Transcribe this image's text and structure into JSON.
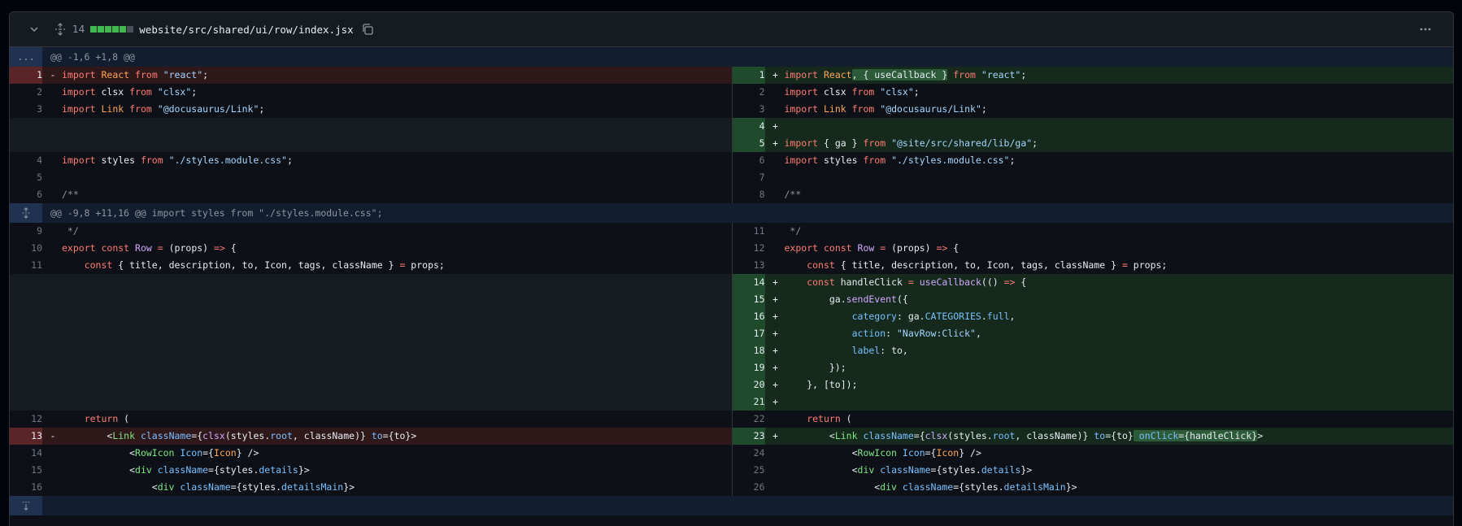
{
  "header": {
    "changes_count": "14",
    "file_path": "website/src/shared/ui/row/index.jsx",
    "diffstat": [
      "add",
      "add",
      "add",
      "add",
      "add",
      "neutral"
    ]
  },
  "hunks": [
    {
      "text": "@@ -1,6 +1,8 @@",
      "expander": "..."
    },
    {
      "text": "@@ -9,8 +11,16 @@ import styles from \"./styles.module.css\";"
    }
  ],
  "rows_a": [
    {
      "l": {
        "n": "1",
        "m": "-",
        "t": "del",
        "h": "<span class='k'>import</span> <span class='v'>React</span> <span class='k'>from</span> <span class='s'>\"react\"</span>;"
      },
      "r": {
        "n": "1",
        "m": "+",
        "t": "add",
        "h": "<span class='k'>import</span> <span class='v'>React</span><span class='hl-add'>, { useCallback }</span> <span class='k'>from</span> <span class='s'>\"react\"</span>;"
      }
    },
    {
      "l": {
        "n": "2",
        "m": "",
        "t": "",
        "h": "<span class='k'>import</span> clsx <span class='k'>from</span> <span class='s'>\"clsx\"</span>;"
      },
      "r": {
        "n": "2",
        "m": "",
        "t": "",
        "h": "<span class='k'>import</span> clsx <span class='k'>from</span> <span class='s'>\"clsx\"</span>;"
      }
    },
    {
      "l": {
        "n": "3",
        "m": "",
        "t": "",
        "h": "<span class='k'>import</span> <span class='v'>Link</span> <span class='k'>from</span> <span class='s'>\"@docusaurus/Link\"</span>;"
      },
      "r": {
        "n": "3",
        "m": "",
        "t": "",
        "h": "<span class='k'>import</span> <span class='v'>Link</span> <span class='k'>from</span> <span class='s'>\"@docusaurus/Link\"</span>;"
      }
    },
    {
      "l": {
        "n": "",
        "m": "",
        "t": "empty",
        "h": ""
      },
      "r": {
        "n": "4",
        "m": "+",
        "t": "add",
        "h": ""
      }
    },
    {
      "l": {
        "n": "",
        "m": "",
        "t": "empty",
        "h": ""
      },
      "r": {
        "n": "5",
        "m": "+",
        "t": "add",
        "h": "<span class='k'>import</span> { ga } <span class='k'>from</span> <span class='s'>\"@site/src/shared/lib/ga\"</span>;"
      }
    },
    {
      "l": {
        "n": "4",
        "m": "",
        "t": "",
        "h": "<span class='k'>import</span> styles <span class='k'>from</span> <span class='s'>\"./styles.module.css\"</span>;"
      },
      "r": {
        "n": "6",
        "m": "",
        "t": "",
        "h": "<span class='k'>import</span> styles <span class='k'>from</span> <span class='s'>\"./styles.module.css\"</span>;"
      }
    },
    {
      "l": {
        "n": "5",
        "m": "",
        "t": "",
        "h": ""
      },
      "r": {
        "n": "7",
        "m": "",
        "t": "",
        "h": ""
      }
    },
    {
      "l": {
        "n": "6",
        "m": "",
        "t": "",
        "h": "<span class='c'>/**</span>"
      },
      "r": {
        "n": "8",
        "m": "",
        "t": "",
        "h": "<span class='c'>/**</span>"
      }
    }
  ],
  "rows_b": [
    {
      "l": {
        "n": "9",
        "m": "",
        "t": "",
        "h": "<span class='c'> */</span>"
      },
      "r": {
        "n": "11",
        "m": "",
        "t": "",
        "h": "<span class='c'> */</span>"
      }
    },
    {
      "l": {
        "n": "10",
        "m": "",
        "t": "",
        "h": "<span class='k'>export</span> <span class='k'>const</span> <span class='f'>Row</span> <span class='k'>=</span> (props) <span class='k'>=&gt;</span> {"
      },
      "r": {
        "n": "12",
        "m": "",
        "t": "",
        "h": "<span class='k'>export</span> <span class='k'>const</span> <span class='f'>Row</span> <span class='k'>=</span> (props) <span class='k'>=&gt;</span> {"
      }
    },
    {
      "l": {
        "n": "11",
        "m": "",
        "t": "",
        "h": "    <span class='k'>const</span> { title, description, to, Icon, tags, className } <span class='k'>=</span> props;"
      },
      "r": {
        "n": "13",
        "m": "",
        "t": "",
        "h": "    <span class='k'>const</span> { title, description, to, Icon, tags, className } <span class='k'>=</span> props;"
      }
    },
    {
      "l": {
        "n": "",
        "m": "",
        "t": "empty",
        "h": ""
      },
      "r": {
        "n": "14",
        "m": "+",
        "t": "add",
        "h": "    <span class='k'>const</span> handleClick <span class='k'>=</span> <span class='f'>useCallback</span>(() <span class='k'>=&gt;</span> {"
      }
    },
    {
      "l": {
        "n": "",
        "m": "",
        "t": "empty",
        "h": ""
      },
      "r": {
        "n": "15",
        "m": "+",
        "t": "add",
        "h": "        ga.<span class='f'>sendEvent</span>({"
      }
    },
    {
      "l": {
        "n": "",
        "m": "",
        "t": "empty",
        "h": ""
      },
      "r": {
        "n": "16",
        "m": "+",
        "t": "add",
        "h": "            <span class='p'>category</span>: ga.<span class='p'>CATEGORIES</span>.<span class='p'>full</span>,"
      }
    },
    {
      "l": {
        "n": "",
        "m": "",
        "t": "empty",
        "h": ""
      },
      "r": {
        "n": "17",
        "m": "+",
        "t": "add",
        "h": "            <span class='p'>action</span>: <span class='s'>\"NavRow:Click\"</span>,"
      }
    },
    {
      "l": {
        "n": "",
        "m": "",
        "t": "empty",
        "h": ""
      },
      "r": {
        "n": "18",
        "m": "+",
        "t": "add",
        "h": "            <span class='p'>label</span>: to,"
      }
    },
    {
      "l": {
        "n": "",
        "m": "",
        "t": "empty",
        "h": ""
      },
      "r": {
        "n": "19",
        "m": "+",
        "t": "add",
        "h": "        });"
      }
    },
    {
      "l": {
        "n": "",
        "m": "",
        "t": "empty",
        "h": ""
      },
      "r": {
        "n": "20",
        "m": "+",
        "t": "add",
        "h": "    }, [to]);"
      }
    },
    {
      "l": {
        "n": "",
        "m": "",
        "t": "empty",
        "h": ""
      },
      "r": {
        "n": "21",
        "m": "+",
        "t": "add",
        "h": ""
      }
    },
    {
      "l": {
        "n": "12",
        "m": "",
        "t": "",
        "h": "    <span class='k'>return</span> ("
      },
      "r": {
        "n": "22",
        "m": "",
        "t": "",
        "h": "    <span class='k'>return</span> ("
      }
    },
    {
      "l": {
        "n": "13",
        "m": "-",
        "t": "del",
        "h": "        &lt;<span class='t'>Link</span> <span class='p'>className</span>={<span class='f'>clsx</span>(styles.<span class='p'>root</span>, className)} <span class='p'>to</span>={to}&gt;"
      },
      "r": {
        "n": "23",
        "m": "+",
        "t": "add",
        "h": "        &lt;<span class='t'>Link</span> <span class='p'>className</span>={<span class='f'>clsx</span>(styles.<span class='p'>root</span>, className)} <span class='p'>to</span>={to}<span class='hl-add'> <span class='p'>onClick</span>={handleClick}</span>&gt;"
      }
    },
    {
      "l": {
        "n": "14",
        "m": "",
        "t": "",
        "h": "            &lt;<span class='t'>RowIcon</span> <span class='p'>Icon</span>={<span class='v'>Icon</span>} /&gt;"
      },
      "r": {
        "n": "24",
        "m": "",
        "t": "",
        "h": "            &lt;<span class='t'>RowIcon</span> <span class='p'>Icon</span>={<span class='v'>Icon</span>} /&gt;"
      }
    },
    {
      "l": {
        "n": "15",
        "m": "",
        "t": "",
        "h": "            &lt;<span class='t'>div</span> <span class='p'>className</span>={styles.<span class='p'>details</span>}&gt;"
      },
      "r": {
        "n": "25",
        "m": "",
        "t": "",
        "h": "            &lt;<span class='t'>div</span> <span class='p'>className</span>={styles.<span class='p'>details</span>}&gt;"
      }
    },
    {
      "l": {
        "n": "16",
        "m": "",
        "t": "",
        "h": "                &lt;<span class='t'>div</span> <span class='p'>className</span>={styles.<span class='p'>detailsMain</span>}&gt;"
      },
      "r": {
        "n": "26",
        "m": "",
        "t": "",
        "h": "                &lt;<span class='t'>div</span> <span class='p'>className</span>={styles.<span class='p'>detailsMain</span>}&gt;"
      }
    }
  ],
  "icons": {
    "collapse": "chevron-down-icon",
    "expand_all": "unfold-icon",
    "copy": "copy-icon",
    "menu": "kebab-horizontal-icon",
    "expand_up_down": "unfold-icon",
    "expand_down": "fold-down-icon"
  }
}
